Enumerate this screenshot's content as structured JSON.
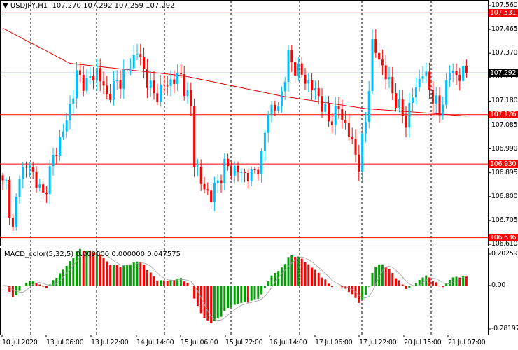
{
  "header": {
    "symbol": "USDJPY,H1",
    "open": "107.270",
    "high": "107.292",
    "low": "107.259",
    "close": "107.292"
  },
  "indicator": {
    "name": "MACD_color(5,32,5)",
    "v1": "0.000000",
    "v2": "0.000000",
    "v3": "0.047575"
  },
  "price_scale": [
    "107.560",
    "107.465",
    "107.370",
    "107.275",
    "107.180",
    "107.085",
    "106.990",
    "106.895",
    "106.800",
    "106.705",
    "106.610"
  ],
  "macd_scale": [
    "0.202591",
    "0.00",
    "-0.281977"
  ],
  "levels": [
    {
      "label": "107.531",
      "value": 107.531,
      "color": "#ff0000"
    },
    {
      "label": "107.126",
      "value": 107.126,
      "color": "#ff0000"
    },
    {
      "label": "106.930",
      "value": 106.93,
      "color": "#ff0000"
    },
    {
      "label": "106.636",
      "value": 106.636,
      "color": "#ff0000"
    }
  ],
  "current": {
    "label": "107.292",
    "value": 107.292
  },
  "time_labels": [
    "10 Jul 2020",
    "13 Jul 06:00",
    "13 Jul 22:00",
    "14 Jul 14:00",
    "15 Jul 06:00",
    "15 Jul 22:00",
    "16 Jul 14:00",
    "17 Jul 06:00",
    "17 Jul 22:00",
    "20 Jul 15:00",
    "21 Jul 07:00"
  ],
  "colors": {
    "bull": "#00bfff",
    "bear": "#ff0000",
    "ma": "#e00000",
    "macd_up": "#00a000",
    "macd_down": "#ff0000"
  },
  "chart_data": {
    "type": "candlestick",
    "price_range": [
      106.61,
      107.56
    ],
    "bars": 139,
    "close_keypoints": [
      [
        1,
        106.85
      ],
      [
        3,
        106.66
      ],
      [
        5,
        106.9
      ],
      [
        8,
        106.92
      ],
      [
        12,
        106.8
      ],
      [
        15,
        106.95
      ],
      [
        19,
        107.1
      ],
      [
        22,
        107.28
      ],
      [
        25,
        107.25
      ],
      [
        28,
        107.3
      ],
      [
        31,
        107.2
      ],
      [
        34,
        107.25
      ],
      [
        37,
        107.3
      ],
      [
        40,
        107.38
      ],
      [
        42,
        107.3
      ],
      [
        45,
        107.2
      ],
      [
        49,
        107.25
      ],
      [
        53,
        107.28
      ],
      [
        56,
        107.15
      ],
      [
        57,
        106.95
      ],
      [
        59,
        106.85
      ],
      [
        62,
        106.8
      ],
      [
        66,
        106.92
      ],
      [
        70,
        106.9
      ],
      [
        74,
        106.88
      ],
      [
        77,
        106.95
      ],
      [
        79,
        107.15
      ],
      [
        82,
        107.15
      ],
      [
        85,
        107.35
      ],
      [
        88,
        107.3
      ],
      [
        91,
        107.25
      ],
      [
        94,
        107.2
      ],
      [
        97,
        107.1
      ],
      [
        100,
        107.15
      ],
      [
        103,
        107.05
      ],
      [
        106,
        106.93
      ],
      [
        108,
        107.1
      ],
      [
        110,
        107.4
      ],
      [
        112,
        107.35
      ],
      [
        115,
        107.25
      ],
      [
        118,
        107.15
      ],
      [
        120,
        107.1
      ],
      [
        122,
        107.2
      ],
      [
        125,
        107.3
      ],
      [
        128,
        107.2
      ],
      [
        130,
        107.13
      ],
      [
        133,
        107.3
      ],
      [
        136,
        107.28
      ],
      [
        138,
        107.292
      ]
    ],
    "ma_keypoints": [
      [
        0,
        107.47
      ],
      [
        20,
        107.33
      ],
      [
        54,
        107.28
      ],
      [
        83,
        107.2
      ],
      [
        108,
        107.15
      ],
      [
        129,
        107.13
      ],
      [
        138,
        107.12
      ]
    ],
    "macd_range": [
      -0.281977,
      0.202591
    ]
  }
}
